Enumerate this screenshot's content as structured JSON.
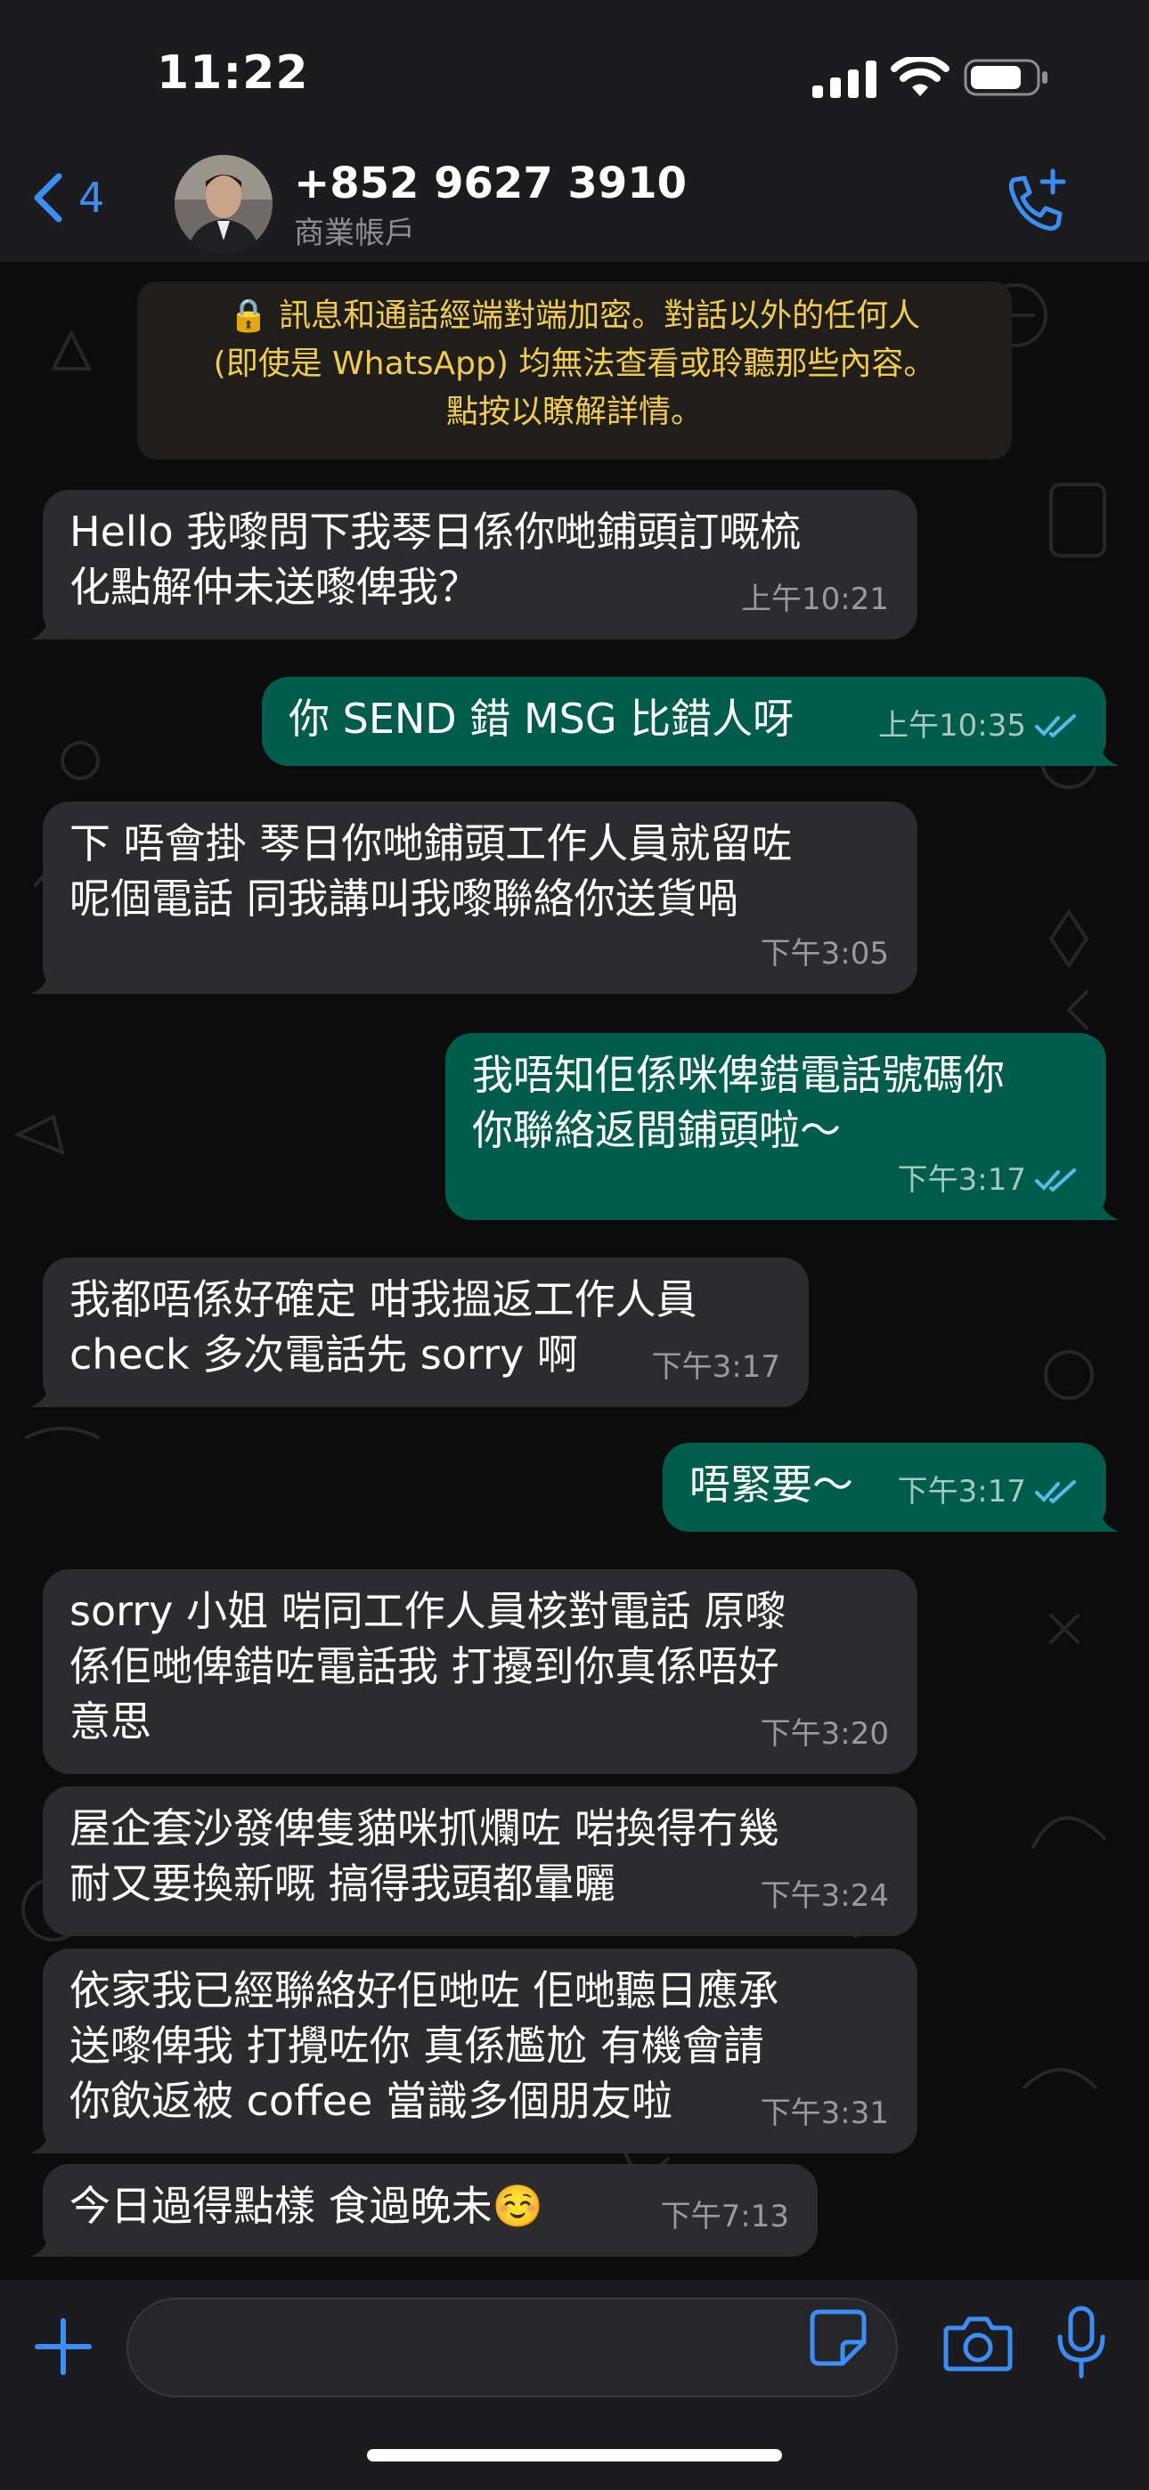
{
  "status_bar": {
    "time": "11:22"
  },
  "header": {
    "back_count": "4",
    "contact_name": "+852 9627 3910",
    "contact_subtitle": "商業帳戶"
  },
  "encryption_notice": {
    "lines": [
      "🔒 訊息和通話經端對端加密。對話以外的任何人",
      "(即使是 WhatsApp) 均無法查看或聆聽那些內容。",
      "點按以瞭解詳情。"
    ]
  },
  "messages": [
    {
      "direction": "incoming",
      "text": "Hello 我嚟問下我琴日係你哋鋪頭訂嘅梳\n化點解仲未送嚟俾我？",
      "time": "上午10:21"
    },
    {
      "direction": "outgoing",
      "text": "你 SEND 錯 MSG 比錯人呀",
      "time": "上午10:35",
      "status": "read"
    },
    {
      "direction": "incoming",
      "text": "下 唔會掛 琴日你哋鋪頭工作人員就留咗\n呢個電話 同我講叫我嚟聯絡你送貨喎",
      "time": "下午3:05"
    },
    {
      "direction": "outgoing",
      "text": "我唔知佢係咪俾錯電話號碼你\n你聯絡返間鋪頭啦～",
      "time": "下午3:17",
      "status": "read"
    },
    {
      "direction": "incoming",
      "text": "我都唔係好確定 咁我搵返工作人員\ncheck 多次電話先 sorry 啊",
      "time": "下午3:17"
    },
    {
      "direction": "outgoing",
      "text": "唔緊要～",
      "time": "下午3:17",
      "status": "read"
    },
    {
      "direction": "incoming",
      "text": "sorry 小姐 啱同工作人員核對電話 原嚟\n係佢哋俾錯咗電話我 打擾到你真係唔好\n意思",
      "time": "下午3:20"
    },
    {
      "direction": "incoming",
      "text": "屋企套沙發俾隻貓咪抓爛咗 啱換得冇幾\n耐又要換新嘅 搞得我頭都暈曬",
      "time": "下午3:24"
    },
    {
      "direction": "incoming",
      "text": "依家我已經聯絡好佢哋咗 佢哋聽日應承\n送嚟俾我 打攪咗你 真係尷尬 有機會請\n你飲返被 coffee 當識多個朋友啦",
      "time": "下午3:31"
    },
    {
      "direction": "incoming",
      "text": "今日過得點樣 食過晚未☺️",
      "time": "下午7:13"
    }
  ],
  "composer": {
    "placeholder": ""
  },
  "colors": {
    "accent": "#3b8ef5",
    "outgoing_bubble": "#005c4b",
    "incoming_bubble": "#2c2c2e",
    "notice_text": "#f1cb4c"
  },
  "icons": [
    "back-chevron-icon",
    "call-add-icon",
    "plus-icon",
    "sticker-icon",
    "camera-icon",
    "mic-icon",
    "lock-icon",
    "read-ticks-icon"
  ]
}
